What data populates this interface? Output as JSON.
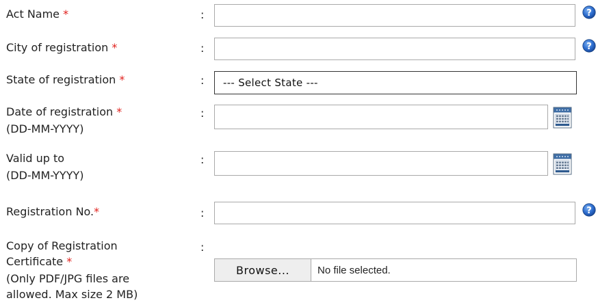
{
  "form": {
    "act_name": {
      "label": "Act Name",
      "required_mark": "*",
      "colon": ":",
      "value": ""
    },
    "city": {
      "label": "City of registration",
      "required_mark": "*",
      "colon": ":",
      "value": ""
    },
    "state": {
      "label": "State of registration",
      "required_mark": "*",
      "colon": ":",
      "selected": "--- Select State ---"
    },
    "date_of_registration": {
      "label": "Date of registration",
      "required_mark": "*",
      "format_hint": "(DD-MM-YYYY)",
      "colon": ":",
      "value": ""
    },
    "valid_up_to": {
      "label": "Valid up to",
      "format_hint": "(DD-MM-YYYY)",
      "colon": ":",
      "value": ""
    },
    "registration_no": {
      "label": "Registration No.",
      "required_mark": "*",
      "colon": ":",
      "value": ""
    },
    "certificate": {
      "label_line1": "Copy of Registration",
      "label_line2": "Certificate",
      "required_mark": "*",
      "note_line1": "(Only PDF/JPG files are",
      "note_line2": "allowed. Max size 2 MB)",
      "colon": ":",
      "browse_label": "Browse...",
      "file_status": "No file selected."
    }
  },
  "icons": {
    "help": "help-question-icon",
    "calendar": "calendar-icon"
  },
  "colors": {
    "required": "#e0201c",
    "help_icon": "#1f5fbf"
  }
}
